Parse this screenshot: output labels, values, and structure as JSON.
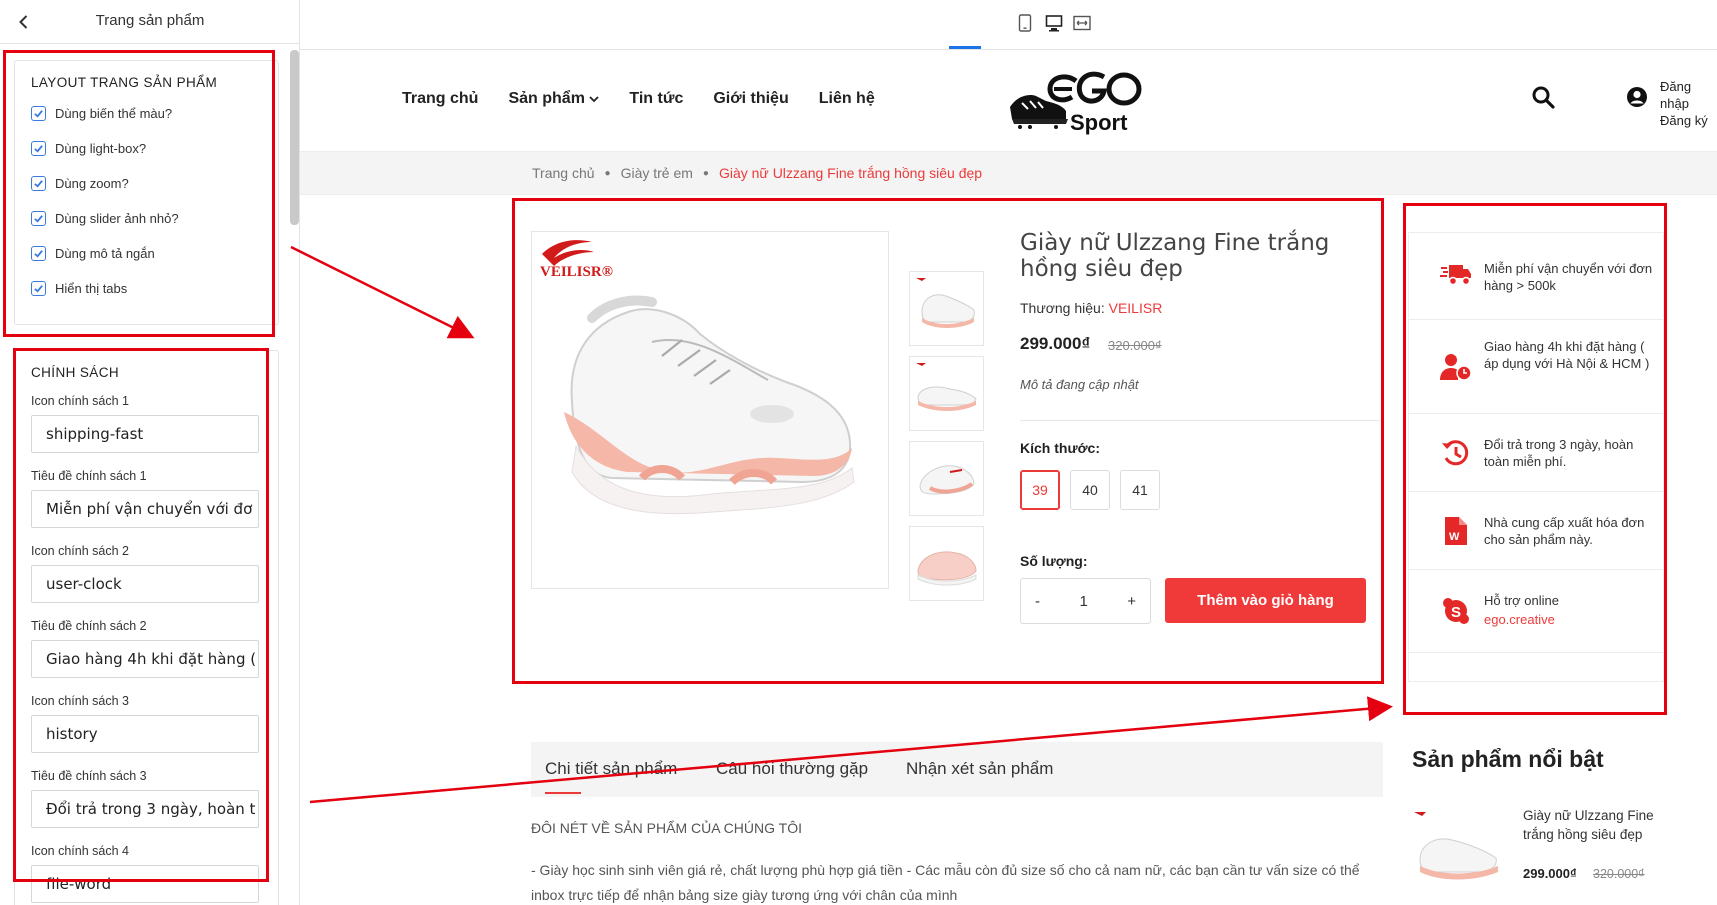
{
  "sidebar": {
    "title": "Trang sản phẩm",
    "layout_card": {
      "title": "LAYOUT TRANG SẢN PHẨM",
      "options": [
        {
          "label": "Dùng biến thể màu?",
          "checked": true
        },
        {
          "label": "Dùng light-box?",
          "checked": true
        },
        {
          "label": "Dùng zoom?",
          "checked": true
        },
        {
          "label": "Dùng slider ảnh nhỏ?",
          "checked": true
        },
        {
          "label": "Dùng mô tả ngắn",
          "checked": true
        },
        {
          "label": "Hiển thị tabs",
          "checked": true
        }
      ]
    },
    "policy_card": {
      "title": "CHÍNH SÁCH",
      "fields": [
        {
          "label": "Icon chính sách 1",
          "value": "shipping-fast"
        },
        {
          "label": "Tiêu đề chính sách 1",
          "value": "Miễn phí vận chuyển với đơ"
        },
        {
          "label": "Icon chính sách 2",
          "value": "user-clock"
        },
        {
          "label": "Tiêu đề chính sách 2",
          "value": "Giao hàng 4h khi đặt hàng ("
        },
        {
          "label": "Icon chính sách 3",
          "value": "history"
        },
        {
          "label": "Tiêu đề chính sách 3",
          "value": "Đổi trả trong 3 ngày, hoàn t"
        },
        {
          "label": "Icon chính sách 4",
          "value": "file-word"
        }
      ]
    }
  },
  "colors": {
    "accent": "#f03a3a",
    "highlight": "#e4000f",
    "checkbox": "#3b7be0",
    "device_active": "#1f73e8"
  },
  "nav": {
    "items": [
      "Trang chủ",
      "Sản phẩm",
      "Tin tức",
      "Giới thiệu",
      "Liên hệ"
    ],
    "login": "Đăng nhập",
    "register": "Đăng ký"
  },
  "logo": {
    "main": "EGO",
    "sub": "Sport"
  },
  "breadcrumb": [
    "Trang chủ",
    "Giày trẻ em",
    "Giày nữ Ulzzang Fine trắng hồng siêu đẹp"
  ],
  "product": {
    "title": "Giày nữ Ulzzang Fine trắng hồng siêu đẹp",
    "brand_label": "Thương hiệu: ",
    "brand": "VEILISR",
    "image_brand": "VEILISR",
    "price": "299.000₫",
    "old_price": "320.000₫",
    "description": "Mô tả đang cập nhật",
    "size_label": "Kích thước:",
    "sizes": [
      "39",
      "40",
      "41"
    ],
    "selected_size": "39",
    "qty_label": "Số lượng:",
    "qty": "1",
    "minus": "-",
    "plus": "+",
    "add_to_cart": "Thêm vào giỏ hàng"
  },
  "policies": [
    {
      "icon": "shipping-fast-icon",
      "text": "Miễn phí vận chuyển với đơn hàng > 500k"
    },
    {
      "icon": "user-clock-icon",
      "text": "Giao hàng 4h khi đặt hàng ( áp dụng với Hà Nội & HCM )"
    },
    {
      "icon": "history-icon",
      "text": "Đổi trả trong 3 ngày, hoàn toàn miễn phí."
    },
    {
      "icon": "file-word-icon",
      "text": "Nhà cung cấp xuất hóa đơn cho sản phẩm này."
    },
    {
      "icon": "skype-icon",
      "text": "Hỗ trợ online",
      "link": "ego.creative"
    }
  ],
  "tabs": [
    "Chi tiết sản phẩm",
    "Câu hỏi thường gặp",
    "Nhận xét sản phẩm"
  ],
  "details": {
    "heading": "ĐÔI NÉT VỀ SẢN PHẨM CỦA CHÚNG TÔI",
    "paragraph": "- Giày học sinh sinh viên giá rẻ, chất lượng phù hợp giá tiền - Các mẫu còn đủ size số cho cả nam nữ, các bạn cần tư vấn size có thể inbox trực tiếp để nhận bảng size giày tương ứng với chân của mình"
  },
  "featured": {
    "heading": "Sản phẩm nổi bật",
    "item_name": "Giày nữ Ulzzang Fine trắng hồng siêu đẹp",
    "item_price": "299.000₫",
    "item_old_price": "320.000₫"
  }
}
